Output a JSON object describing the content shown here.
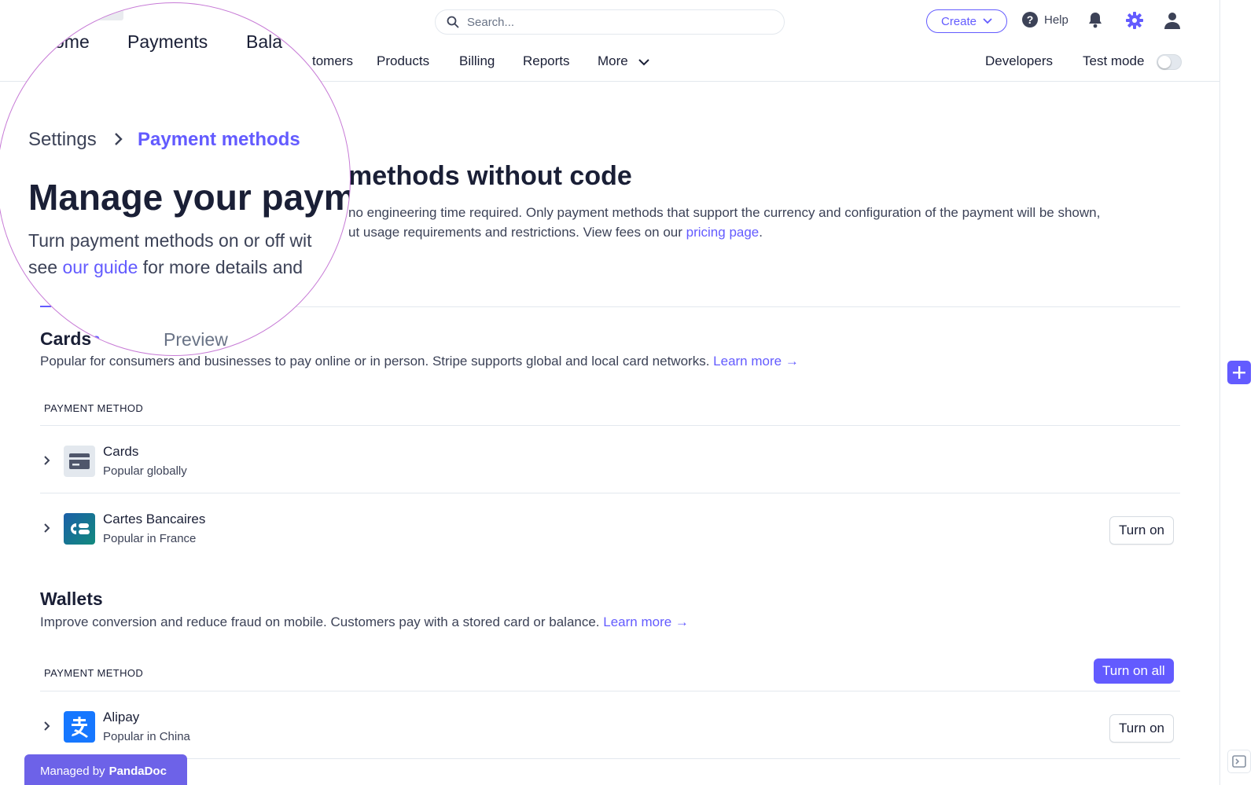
{
  "topbar": {
    "search_placeholder": "Search...",
    "create_label": "Create",
    "help_label": "Help",
    "nav": [
      "Customers",
      "Products",
      "Billing",
      "Reports",
      "More"
    ],
    "nav_visible": [
      "tomers",
      "Products",
      "Billing",
      "Reports",
      "More"
    ],
    "developers_label": "Developers",
    "test_mode_label": "Test mode"
  },
  "page": {
    "title_visible": "methods without code",
    "desc_line1": "no engineering time required. Only payment methods that support the currency and configuration of the payment will be shown,",
    "desc_line2_pre": "ut usage requirements and restrictions. View fees on our ",
    "pricing_link": "pricing page",
    "desc_line2_post": "."
  },
  "lens": {
    "nav": [
      "ome",
      "Payments",
      "Bala"
    ],
    "breadcrumb_parent": "Settings",
    "breadcrumb_current": "Payment methods",
    "title": "Manage your paym",
    "desc_line1": "Turn payment methods on or off wit",
    "desc_line2_pre": "see ",
    "guide_link": "our guide",
    "desc_line2_post": " for more details and",
    "tab_active": "n",
    "tab_preview": "Preview"
  },
  "cards_section": {
    "title": "Cards",
    "desc": "Popular for consumers and businesses to pay online or in person. Stripe supports global and local card networks. ",
    "learn_more": "Learn more →",
    "column_header": "PAYMENT METHOD",
    "rows": [
      {
        "name": "Cards",
        "sub": "Popular globally",
        "icon": "card-icon",
        "button": ""
      },
      {
        "name": "Cartes Bancaires",
        "sub": "Popular in France",
        "icon": "cartes-bancaires-logo",
        "button": "Turn on"
      }
    ]
  },
  "wallets_section": {
    "title": "Wallets",
    "desc": "Improve conversion and reduce fraud on mobile. Customers pay with a stored card or balance. ",
    "learn_more": "Learn more →",
    "column_header": "PAYMENT METHOD",
    "turn_on_all": "Turn on all",
    "rows": [
      {
        "name": "Alipay",
        "sub": "Popular in China",
        "icon": "alipay-logo",
        "button": "Turn on"
      }
    ]
  },
  "footer_badge": {
    "prefix": "Managed by",
    "brand": "PandaDoc"
  },
  "colors": {
    "accent": "#635bff",
    "text": "#1a1f36",
    "muted": "#3c4257",
    "border": "#e3e8ee",
    "lens_border": "#c77bd6",
    "badge": "#6d62e8"
  }
}
